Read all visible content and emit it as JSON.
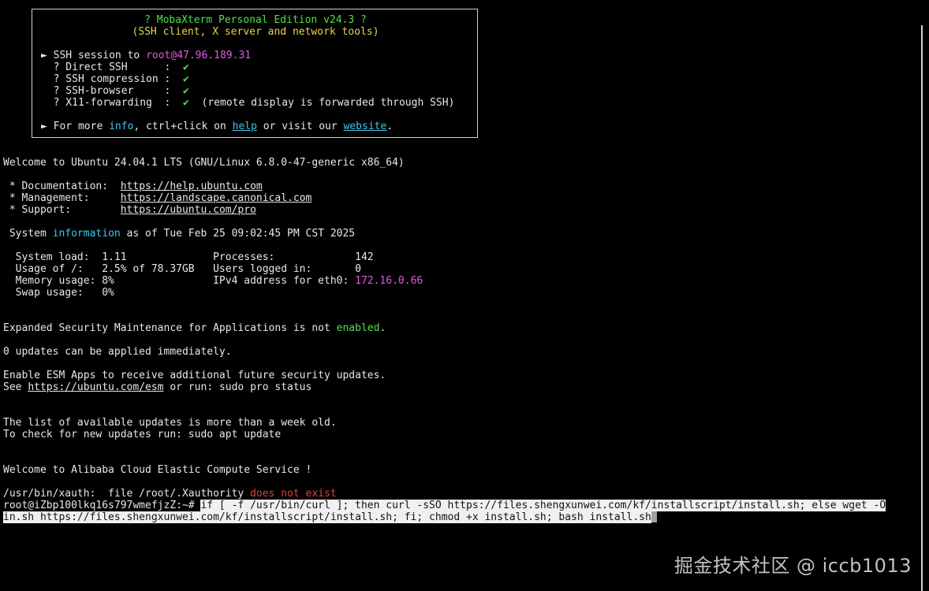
{
  "banner": {
    "title": "? MobaXterm Personal Edition v24.3 ?",
    "subtitle": "(SSH client, X server and network tools)",
    "session_prefix": "► SSH session to ",
    "session_host": "root@47.96.189.31",
    "direct_ssh": "? Direct SSH      :  ",
    "ssh_compression": "? SSH compression :  ",
    "ssh_browser": "? SSH-browser     :  ",
    "x11_forwarding": "? X11-forwarding  :  ",
    "check": "✔",
    "x11_note": "  (remote display is forwarded through SSH)",
    "more_prefix": "► For more ",
    "info_word": "info",
    "more_mid": ", ctrl+click on ",
    "help_link": "help",
    "more_mid2": " or visit our ",
    "website_link": "website",
    "more_end": "."
  },
  "motd": {
    "welcome": "Welcome to Ubuntu 24.04.1 LTS (GNU/Linux 6.8.0-47-generic x86_64)",
    "doc_label": " * Documentation:  ",
    "doc_url": "https://help.ubuntu.com",
    "mgmt_label": " * Management:     ",
    "mgmt_url": "https://landscape.canonical.com",
    "support_label": " * Support:        ",
    "support_url": "https://ubuntu.com/pro",
    "sysinfo_prefix": " System ",
    "sysinfo_word": "information",
    "sysinfo_suffix": " as of Tue Feb 25 09:02:45 PM CST 2025",
    "row1": "  System load:  1.11              Processes:             142",
    "row2": "  Usage of /:   2.5% of 78.37GB   Users logged in:       0",
    "row3_prefix": "  Memory usage: 8%                IPv4 address for eth0: ",
    "row3_ip": "172.16.0.66",
    "row4": "  Swap usage:   0%",
    "esm_prefix": "Expanded Security Maintenance for Applications is not ",
    "esm_word": "enabled",
    "esm_end": ".",
    "updates": "0 updates can be applied immediately.",
    "esm_apps": "Enable ESM Apps to receive additional future security updates.",
    "see_prefix": "See ",
    "see_url": "https://ubuntu.com/esm",
    "see_suffix": " or run: sudo pro status",
    "list_old": "The list of available updates is more than a week old.",
    "check_updates": "To check for new updates run: sudo apt update",
    "alibaba": "Welcome to Alibaba Cloud Elastic Compute Service !",
    "xauth_prefix": "/usr/bin/xauth:  file /root/.Xauthority ",
    "xauth_err": "does not exist"
  },
  "prompt": {
    "text": "root@iZbp100lkq16s797wmefjzZ:~# ",
    "cmd_line1": "if [ -f /usr/bin/curl ]; then curl -sSO https://files.shengxunwei.com/kf/installscript/install.sh; else wget -O",
    "cmd_line2": "in.sh https://files.shengxunwei.com/kf/installscript/install.sh; fi; chmod +x install.sh; bash install.sh"
  },
  "watermark": "掘金技术社区 @ iccb1013"
}
